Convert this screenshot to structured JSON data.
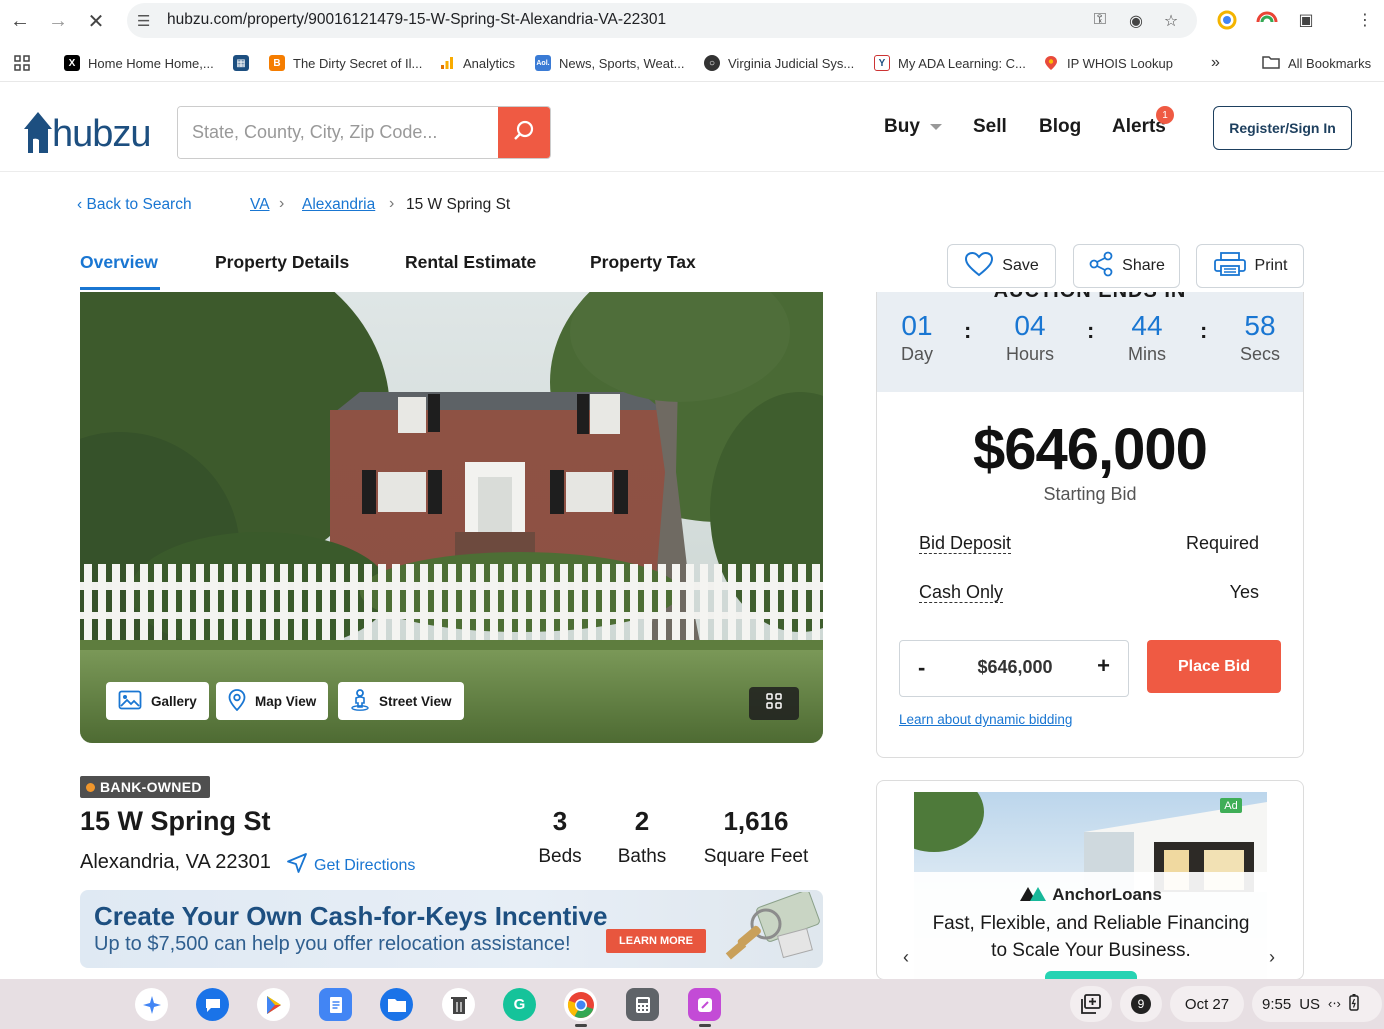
{
  "browser": {
    "url": "hubzu.com/property/90016121479-15-W-Spring-St-Alexandria-VA-22301",
    "bookmarks": [
      {
        "label": "Home Home Home,...",
        "icon": "x-icon",
        "color": "#000000"
      },
      {
        "label": "",
        "icon": "building-icon",
        "color": "#1d4f80"
      },
      {
        "label": "The Dirty Secret of Il...",
        "icon": "blogger-icon",
        "color": "#f57d00"
      },
      {
        "label": "Analytics",
        "icon": "analytics-icon",
        "color": "#f9ab00"
      },
      {
        "label": "News, Sports, Weat...",
        "icon": "aol-icon",
        "color": "#3a7bd5"
      },
      {
        "label": "Virginia Judicial Sys...",
        "icon": "seal-icon",
        "color": "#333333"
      },
      {
        "label": "My ADA Learning: C...",
        "icon": "ada-icon",
        "color": "#1d4f80"
      },
      {
        "label": "IP WHOIS Lookup",
        "icon": "location-pin-icon",
        "color": "#e84b3c"
      }
    ],
    "all_bookmarks": "All Bookmarks"
  },
  "header": {
    "logo_text": "hubzu",
    "search_placeholder": "State, County, City, Zip Code...",
    "nav": {
      "buy": "Buy",
      "sell": "Sell",
      "blog": "Blog",
      "alerts": "Alerts"
    },
    "alerts_count": "1",
    "register": "Register/Sign In"
  },
  "breadcrumb": {
    "back": "Back to Search",
    "state": "VA",
    "city": "Alexandria",
    "current": "15 W Spring St"
  },
  "tabs": [
    "Overview",
    "Property Details",
    "Rental Estimate",
    "Property Tax"
  ],
  "actions": {
    "save": "Save",
    "share": "Share",
    "print": "Print"
  },
  "photo_buttons": {
    "gallery": "Gallery",
    "map": "Map View",
    "street": "Street View"
  },
  "listing": {
    "badge": "BANK-OWNED",
    "street": "15 W Spring St",
    "city_line": "Alexandria, VA 22301",
    "directions": "Get Directions",
    "beds": "3",
    "beds_label": "Beds",
    "baths": "2",
    "baths_label": "Baths",
    "sqft": "1,616",
    "sqft_label": "Square Feet"
  },
  "promo": {
    "headline": "Create Your Own Cash-for-Keys Incentive",
    "sub": "Up to $7,500 can help you offer relocation assistance!",
    "cta": "LEARN MORE"
  },
  "auction": {
    "title": "AUCTION ENDS IN",
    "countdown": [
      {
        "value": "01",
        "label": "Day"
      },
      {
        "value": "04",
        "label": "Hours"
      },
      {
        "value": "44",
        "label": "Mins"
      },
      {
        "value": "58",
        "label": "Secs"
      }
    ],
    "price": "$646,000",
    "price_label": "Starting Bid",
    "bid_deposit_label": "Bid Deposit",
    "bid_deposit_value": "Required",
    "cash_only_label": "Cash Only",
    "cash_only_value": "Yes",
    "bid_amount": "$646,000",
    "minus": "-",
    "plus": "+",
    "place_bid": "Place Bid",
    "dynamic_link": "Learn about dynamic bidding"
  },
  "ad": {
    "tag": "Ad",
    "brand": "AnchorLoans",
    "line1": "Fast, Flexible, and Reliable Financing",
    "line2": "to Scale Your Business.",
    "prev": "‹",
    "next": "›"
  },
  "shelf": {
    "notifications": "9",
    "date": "Oct 27",
    "time": "9:55",
    "locale": "US"
  }
}
